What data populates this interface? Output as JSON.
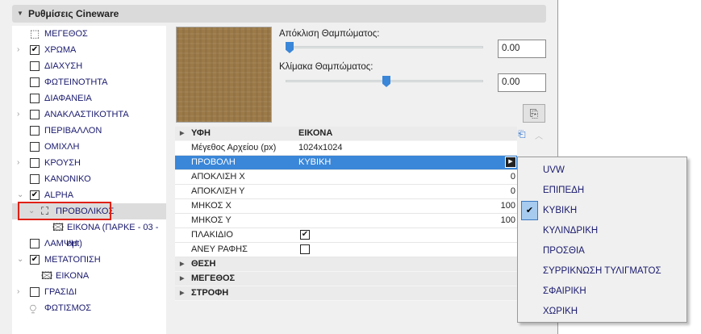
{
  "header": {
    "title": "Ρυθμίσεις Cineware"
  },
  "tree": [
    {
      "label": "ΜΕΓΕΘΟΣ",
      "icon": "size-icon"
    },
    {
      "label": "ΧΡΩΜΑ",
      "checked": true,
      "expander": "collapsed"
    },
    {
      "label": "ΔΙΑΧΥΣΗ",
      "checked": false
    },
    {
      "label": "ΦΩΤΕΙΝΟΤΗΤΑ",
      "checked": false
    },
    {
      "label": "ΔΙΑΦΑΝΕΙΑ",
      "checked": false
    },
    {
      "label": "ΑΝΑΚΛΑΣΤΙΚΟΤΗΤΑ",
      "checked": false,
      "expander": "collapsed"
    },
    {
      "label": "ΠΕΡΙΒΑΛΛΟΝ",
      "checked": false
    },
    {
      "label": "ΟΜΙΧΛΗ",
      "checked": false
    },
    {
      "label": "ΚΡΟΥΣΗ",
      "checked": false,
      "expander": "collapsed"
    },
    {
      "label": "ΚΑΝΟΝΙΚΟ",
      "checked": false
    },
    {
      "label": "ALPHA",
      "checked": true,
      "expander": "expanded"
    },
    {
      "label": "ΠΡΟΒΟΛΙΚΟΣ",
      "icon": "projector-icon",
      "expander": "expanded",
      "selected": true
    },
    {
      "label": "ΕΙΚΟΝΑ (ΠΑΡΚΕ - 03 -opt)",
      "icon": "image-icon"
    },
    {
      "label": "ΛΑΜΨΗ",
      "checked": false
    },
    {
      "label": "ΜΕΤΑΤΟΠΙΣΗ",
      "checked": true,
      "expander": "expanded"
    },
    {
      "label": "ΕΙΚΟΝΑ",
      "icon": "image-icon"
    },
    {
      "label": "ΓΡΑΣΙΔΙ",
      "checked": false,
      "expander": "collapsed"
    },
    {
      "label": "ΦΩΤΙΣΜΟΣ",
      "icon": "lighting-icon"
    }
  ],
  "blur_offset": {
    "label": "Απόκλιση Θαμπώματος:",
    "value": "0.00",
    "slider_fraction": 0.0
  },
  "blur_scale": {
    "label": "Κλίμακα Θαμπώματος:",
    "value": "0.00",
    "slider_fraction": 0.5
  },
  "properties": {
    "header": {
      "key": "ΥΦΗ",
      "value": "ΕΙΚΟΝΑ"
    },
    "rows": [
      {
        "key": "Μέγεθος Αρχείου (px)",
        "value": "1024x1024"
      },
      {
        "key": "ΠΡΟΒΟΛΗ",
        "value": "ΚΥΒΙΚΗ"
      },
      {
        "key": "ΑΠΟΚΛΙΣΗ Χ",
        "value": "0"
      },
      {
        "key": "ΑΠΟΚΛΙΣΗ Υ",
        "value": "0"
      },
      {
        "key": "ΜΗΚΟΣ Χ",
        "value": "100"
      },
      {
        "key": "ΜΗΚΟΣ Υ",
        "value": "100"
      },
      {
        "key": "ΠΛΑΚΙΔΙΟ",
        "checked": true
      },
      {
        "key": "ΑΝΕΥ ΡΑΦΗΣ",
        "checked": false
      }
    ],
    "groups": [
      "ΘΕΣΗ",
      "ΜΕΓΕΘΟΣ",
      "ΣΤΡΟΦΗ"
    ]
  },
  "projection_menu": {
    "items": [
      "UVW",
      "ΕΠΙΠΕΔΗ",
      "ΚΥΒΙΚΗ",
      "ΚΥΛΙΝΔΡΙΚΗ",
      "ΠΡΟΣΘΙΑ",
      "ΣΥΡΡΙΚΝΩΣΗ ΤΥΛΙΓΜΑΤΟΣ",
      "ΣΦΑΙΡΙΚΗ",
      "ΧΩΡΙΚΗ"
    ],
    "selected": "ΚΥΒΙΚΗ"
  },
  "colors": {
    "accent": "#3a86d8",
    "highlight_box": "#e02010"
  }
}
